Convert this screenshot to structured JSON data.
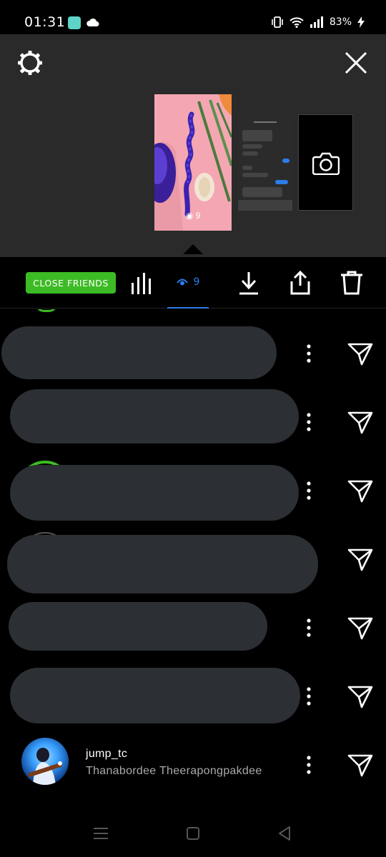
{
  "status_bar": {
    "time": "01:31",
    "battery_text": "83%",
    "icons": [
      "app-notification-icon",
      "cloud-icon",
      "vibrate-icon",
      "wifi-icon",
      "signal-icon",
      "charging-icon"
    ]
  },
  "header": {
    "settings_icon": "settings-gear-icon",
    "close_icon": "close-icon",
    "thumbnails": [
      {
        "kind": "photo",
        "viewers": "9"
      },
      {
        "kind": "chat-screenshot"
      },
      {
        "kind": "camera",
        "icon": "camera-icon"
      }
    ]
  },
  "toolbar": {
    "close_friends_label": "CLOSE FRIENDS",
    "viewers_count": "9",
    "icons": [
      "insights-bars-icon",
      "eye-icon",
      "download-icon",
      "share-icon",
      "delete-icon"
    ],
    "accent_color": "#2b7de9",
    "close_friends_color": "#3dbb24"
  },
  "viewers": [
    {
      "redacted": true
    },
    {
      "redacted": true
    },
    {
      "redacted": true
    },
    {
      "redacted": true
    },
    {
      "redacted": true
    },
    {
      "redacted": true
    },
    {
      "redacted": false,
      "username": "jump_tc",
      "full_name": "Thanabordee Theerapongpakdee"
    }
  ],
  "nav_bar": {
    "icons": [
      "recent-apps-icon",
      "home-icon",
      "back-icon"
    ]
  }
}
